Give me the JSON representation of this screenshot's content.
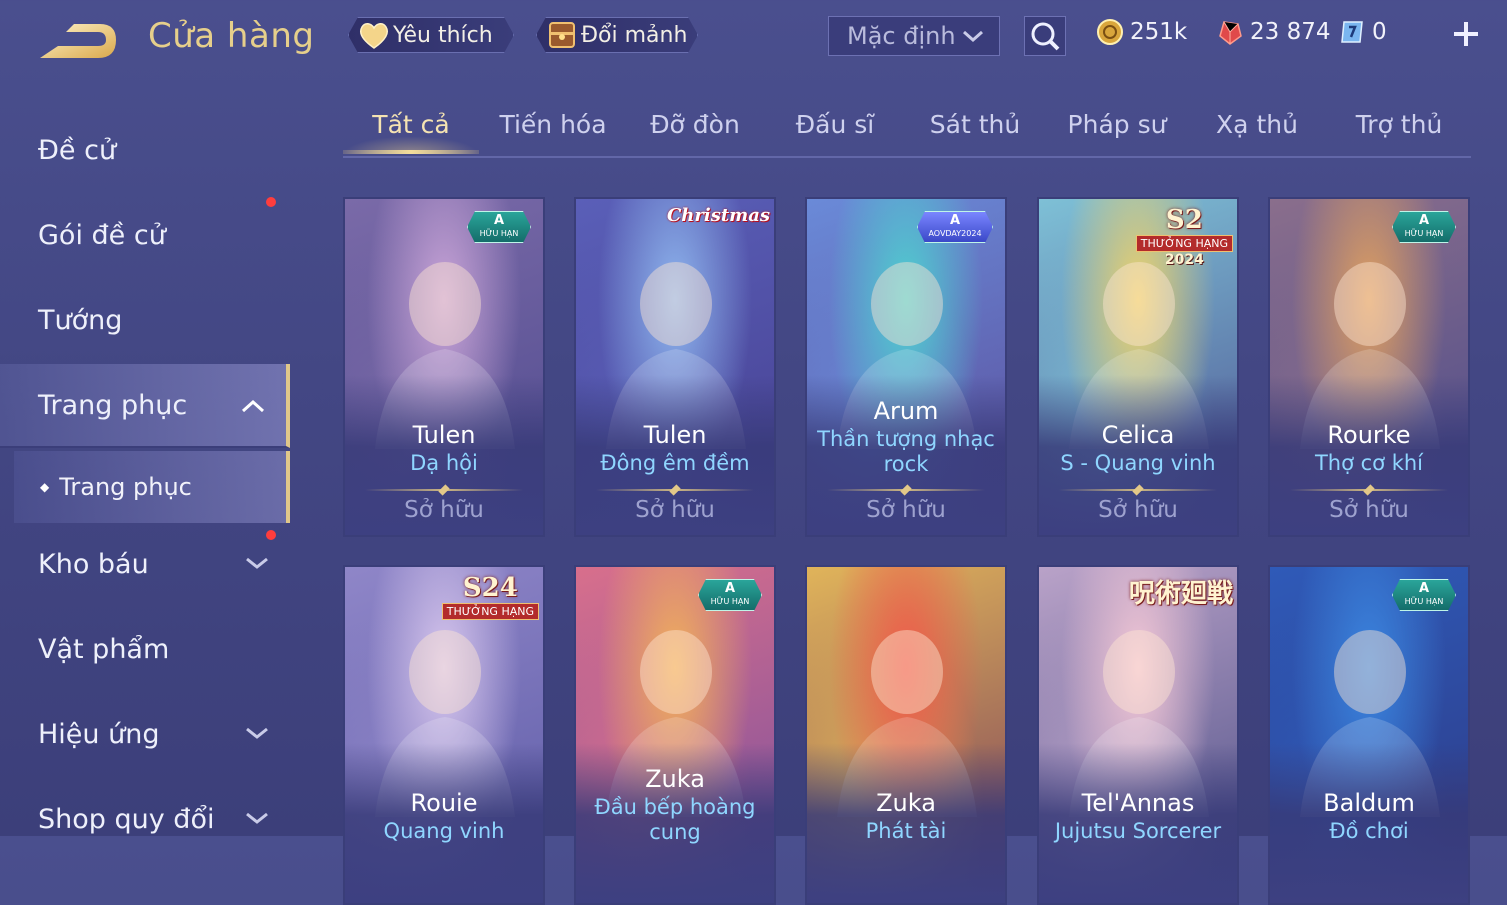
{
  "header": {
    "title": "Cửa hàng",
    "favorites_label": "Yêu thích",
    "exchange_label": "Đổi mảnh",
    "sort_value": "Mặc định",
    "gold": "251k",
    "gems": "23 874",
    "tickets": "0"
  },
  "sidebar": {
    "items": [
      {
        "label": "Đề cử"
      },
      {
        "label": "Gói đề cử"
      },
      {
        "label": "Tướng"
      },
      {
        "label": "Trang phục"
      },
      {
        "label": "Trang phục"
      },
      {
        "label": "Kho báu"
      },
      {
        "label": "Vật phẩm"
      },
      {
        "label": "Hiệu ứng"
      },
      {
        "label": "Shop quy đổi"
      }
    ]
  },
  "tabs": [
    "Tất cả",
    "Tiến hóa",
    "Đỡ đòn",
    "Đấu sĩ",
    "Sát thủ",
    "Pháp sư",
    "Xạ thủ",
    "Trợ thủ"
  ],
  "cards": [
    {
      "hero": "Tulen",
      "skin": "Dạ hội",
      "status": "Sở hữu",
      "badge": "A",
      "badge_sub": "HỮU HẠN",
      "colors": [
        "#caa5d8",
        "#7a6aa8",
        "#4f4a8e"
      ]
    },
    {
      "hero": "Tulen",
      "skin": "Đông êm đềm",
      "status": "Sở hữu",
      "badge": "Christmas",
      "colors": [
        "#8fb7ef",
        "#5a5fb8",
        "#463f90"
      ]
    },
    {
      "hero": "Arum",
      "skin": "Thần tượng nhạc rock",
      "status": "Sở hữu",
      "badge": "A",
      "badge_sub": "AOVDAY2024",
      "colors": [
        "#4fd1d0",
        "#6a8ad8",
        "#5a4c9a"
      ]
    },
    {
      "hero": "Celica",
      "skin": "S - Quang vinh",
      "status": "Sở hữu",
      "badge": "S2",
      "badge_sub": "THƯỞNG HẠNG",
      "badge_year": "2024",
      "colors": [
        "#f0d36a",
        "#7ec0d6",
        "#4d5392"
      ]
    },
    {
      "hero": "Rourke",
      "skin": "Thợ cơ khí",
      "status": "Sở hữu",
      "badge": "A",
      "badge_sub": "HỮU HẠN",
      "colors": [
        "#e0a060",
        "#8a6e8c",
        "#4a4a8a"
      ]
    },
    {
      "hero": "Rouie",
      "skin": "Quang vinh",
      "status": "",
      "badge": "S24",
      "badge_sub": "THƯỞNG HẠNG",
      "colors": [
        "#d8c7ee",
        "#8f86c8",
        "#5c5aa6"
      ]
    },
    {
      "hero": "Zuka",
      "skin": "Đầu bếp hoàng cung",
      "status": "",
      "badge": "A",
      "badge_sub": "HỮU HẠN",
      "colors": [
        "#f2b25a",
        "#d86f8c",
        "#7a4f9e"
      ]
    },
    {
      "hero": "Zuka",
      "skin": "Phát tài",
      "status": "",
      "badge": "",
      "colors": [
        "#f05a4a",
        "#e0b45a",
        "#7a3e5a"
      ]
    },
    {
      "hero": "Tel'Annas",
      "skin": "Jujutsu Sorcerer",
      "status": "",
      "badge": "呪術廻戦",
      "colors": [
        "#f4c8d6",
        "#b9a2c8",
        "#4c4e86"
      ]
    },
    {
      "hero": "Baldum",
      "skin": "Đồ chơi",
      "status": "",
      "badge": "A",
      "badge_sub": "HỮU HẠN",
      "colors": [
        "#3b86e0",
        "#2f5ab8",
        "#2d3a86"
      ]
    }
  ]
}
